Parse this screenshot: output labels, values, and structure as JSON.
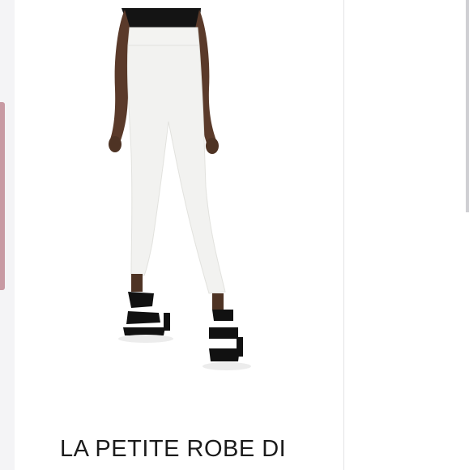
{
  "listing": {
    "brand_title": "LA PETITE ROBE DI"
  },
  "image": {
    "subject": "white-leggings-with-black-strappy-heels"
  },
  "colors": {
    "accent_indicator": "#c89aa3",
    "background": "#ffffff",
    "title": "#1b1b1b"
  }
}
